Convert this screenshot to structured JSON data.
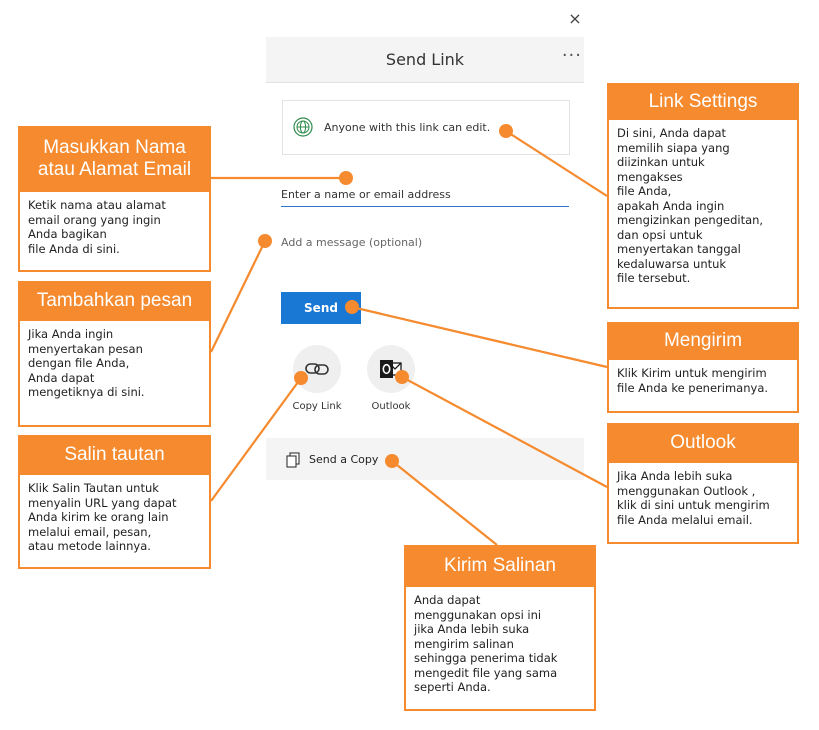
{
  "dialog": {
    "title": "Send Link",
    "more_label": "···",
    "close_label": "×",
    "link_settings": "Anyone with this link can edit.",
    "email_placeholder": "Enter a name or email address",
    "message_placeholder": "Add a message (optional)",
    "send_label": "Send",
    "copy_link_label": "Copy Link",
    "outlook_label": "Outlook",
    "send_copy_label": "Send a Copy"
  },
  "colors": {
    "accent_orange": "#f58a2e",
    "send_blue": "#1878d4",
    "input_underline": "#2a75c7"
  },
  "callouts": {
    "link_settings": {
      "title": "Link Settings",
      "body": "Di sini, Anda dapat\nmemilih siapa yang\ndiizinkan untuk\nmengakses\nfile Anda,\napakah Anda ingin\nmengizinkan pengeditan,\ndan opsi untuk\nmenyertakan tanggal\nkedaluwarsa untuk\nfile tersebut."
    },
    "email": {
      "title": "Masukkan Nama atau Alamat Email",
      "body": "Ketik nama atau alamat\nemail orang yang ingin\nAnda bagikan\nfile Anda di sini."
    },
    "message": {
      "title": "Tambahkan pesan",
      "body": "Jika Anda ingin\nmenyertakan pesan\ndengan file Anda,\nAnda dapat\nmengetiknya di sini."
    },
    "send": {
      "title": "Mengirim",
      "body": "Klik Kirim untuk mengirim\nfile Anda ke penerimanya."
    },
    "copy_link": {
      "title": "Salin tautan",
      "body": "Klik Salin Tautan untuk\nmenyalin URL yang dapat\nAnda kirim ke orang lain\nmelalui email, pesan,\natau metode lainnya."
    },
    "outlook": {
      "title": "Outlook",
      "body": "Jika Anda lebih suka\nmenggunakan  Outlook ,\nklik di sini untuk mengirim\nfile Anda melalui email."
    },
    "send_copy": {
      "title": "Kirim Salinan",
      "body": "Anda dapat\nmenggunakan opsi ini\njika Anda lebih suka\nmengirim salinan\nsehingga penerima tidak\nmengedit file yang sama\nseperti Anda."
    }
  }
}
